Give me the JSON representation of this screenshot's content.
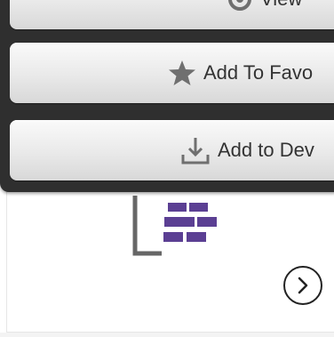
{
  "menu": {
    "view_label": "View",
    "favorite_label": "Add To Favo",
    "device_label": "Add to Dev"
  },
  "icons": {
    "view": "eye-icon",
    "favorite": "star-icon",
    "device": "download-icon",
    "next": "chevron-right-icon"
  },
  "colors": {
    "popover_bg": "#2f2f2f",
    "accent": "#5b3f93",
    "icon_gray": "#6f6f6f"
  }
}
